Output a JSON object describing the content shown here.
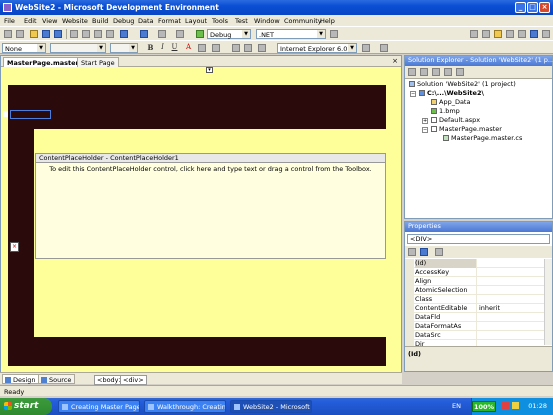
{
  "window": {
    "title": "WebSite2 - Microsoft Development Environment",
    "minimize": "_",
    "maximize": "□",
    "close": "×"
  },
  "menu": [
    "File",
    "Edit",
    "View",
    "Website",
    "Build",
    "Debug",
    "Data",
    "Format",
    "Layout",
    "Tools",
    "Test",
    "Window",
    "Community",
    "Help"
  ],
  "toolbar": {
    "config": "Debug",
    "platform": ".NET",
    "style_combo": "None",
    "browser_combo": "Internet Explorer 6.0",
    "bold": "B",
    "italic": "I",
    "underline": "U",
    "font_color": "A"
  },
  "doc_tabs": {
    "active": "MasterPage.master*",
    "other": "Start Page",
    "close": "×"
  },
  "design": {
    "cph_title": "ContentPlaceHolder - ContentPlaceHolder1",
    "cph_message": "To edit this ContentPlaceHolder control, click here and type text or drag a control from the Toolbox.",
    "collapse_glyph": "▾",
    "marker_glyph": "×"
  },
  "view_tabs": {
    "design": "Design",
    "source": "Source",
    "crumbs": [
      "<body>",
      "<div>"
    ]
  },
  "solution_explorer": {
    "title": "Solution Explorer - Solution 'WebSite2' (1 p...",
    "nodes": [
      {
        "label": "Solution 'WebSite2' (1 project)",
        "expander": ""
      },
      {
        "label": "C:\\...\\WebSite2\\",
        "expander": "−"
      },
      {
        "label": "App_Data",
        "expander": ""
      },
      {
        "label": "1.bmp",
        "expander": ""
      },
      {
        "label": "Default.aspx",
        "expander": "+"
      },
      {
        "label": "MasterPage.master",
        "expander": "−"
      },
      {
        "label": "MasterPage.master.cs",
        "expander": ""
      }
    ]
  },
  "properties": {
    "title": "Properties",
    "object": "<DIV>",
    "rows": [
      {
        "name": "(Id)",
        "value": ""
      },
      {
        "name": "AccessKey",
        "value": ""
      },
      {
        "name": "Align",
        "value": ""
      },
      {
        "name": "AtomicSelection",
        "value": ""
      },
      {
        "name": "Class",
        "value": ""
      },
      {
        "name": "ContentEditable",
        "value": "inherit"
      },
      {
        "name": "DataFld",
        "value": ""
      },
      {
        "name": "DataFormatAs",
        "value": ""
      },
      {
        "name": "DataSrc",
        "value": ""
      },
      {
        "name": "Dir",
        "value": ""
      }
    ],
    "description": "(Id)"
  },
  "status": "Ready",
  "taskbar": {
    "start": "start",
    "tasks": [
      "Creating Master Page...",
      "Walkthrough: Creatin...",
      "WebSite2 - Microsoft ..."
    ],
    "lang": "EN",
    "battery": "100%",
    "clock": "01:28"
  },
  "colors": {
    "design_bg": "#ffff99",
    "master_dark": "#2a0a0a",
    "titlebar": "#0b4ed4"
  }
}
